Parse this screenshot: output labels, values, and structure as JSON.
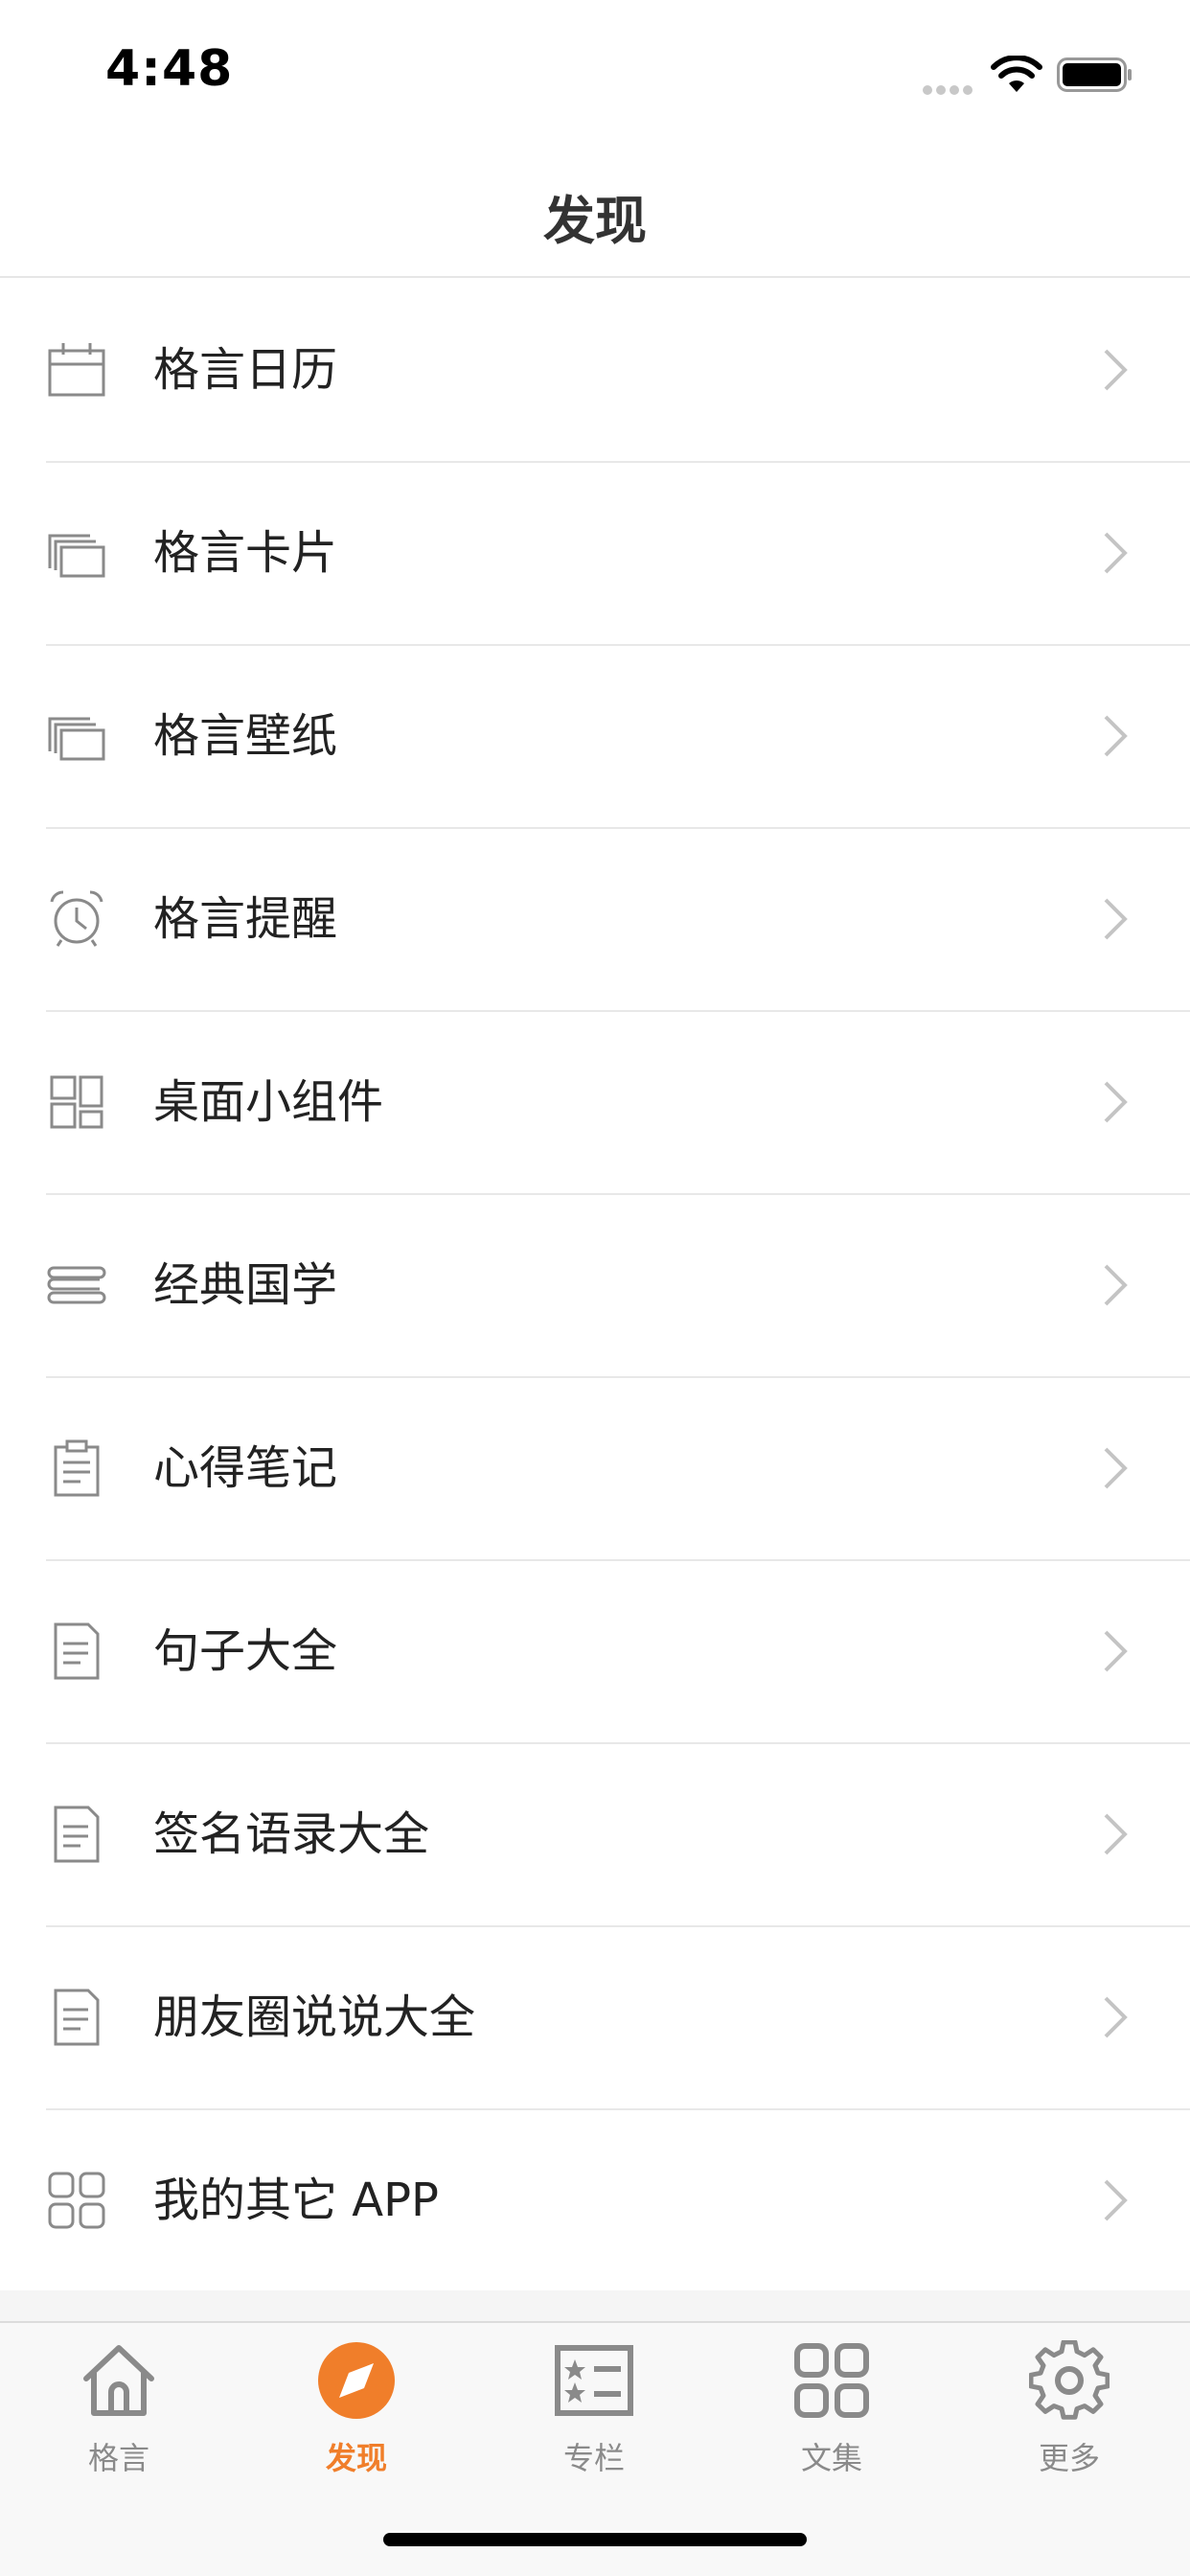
{
  "status_bar": {
    "time": "4:48"
  },
  "nav": {
    "title": "发现"
  },
  "list": {
    "items": [
      {
        "label": "格言日历",
        "icon": "calendar-icon"
      },
      {
        "label": "格言卡片",
        "icon": "cards-icon"
      },
      {
        "label": "格言壁纸",
        "icon": "wallpaper-icon"
      },
      {
        "label": "格言提醒",
        "icon": "alarm-clock-icon"
      },
      {
        "label": "桌面小组件",
        "icon": "widgets-icon"
      },
      {
        "label": "经典国学",
        "icon": "scroll-icon"
      },
      {
        "label": "心得笔记",
        "icon": "clipboard-icon"
      },
      {
        "label": "句子大全",
        "icon": "document-icon"
      },
      {
        "label": "签名语录大全",
        "icon": "document-icon"
      },
      {
        "label": "朋友圈说说大全",
        "icon": "document-icon"
      },
      {
        "label": "我的其它 APP",
        "icon": "apps-grid-icon"
      }
    ]
  },
  "tab_bar": {
    "tabs": [
      {
        "label": "格言",
        "icon": "home-icon",
        "active": false
      },
      {
        "label": "发现",
        "icon": "compass-icon",
        "active": true
      },
      {
        "label": "专栏",
        "icon": "column-list-icon",
        "active": false
      },
      {
        "label": "文集",
        "icon": "collection-grid-icon",
        "active": false
      },
      {
        "label": "更多",
        "icon": "gear-icon",
        "active": false
      }
    ]
  },
  "colors": {
    "accent": "#f07e2a",
    "icon_gray": "#8a8a8a",
    "text": "#222222",
    "chevron": "#c4c4c4"
  }
}
